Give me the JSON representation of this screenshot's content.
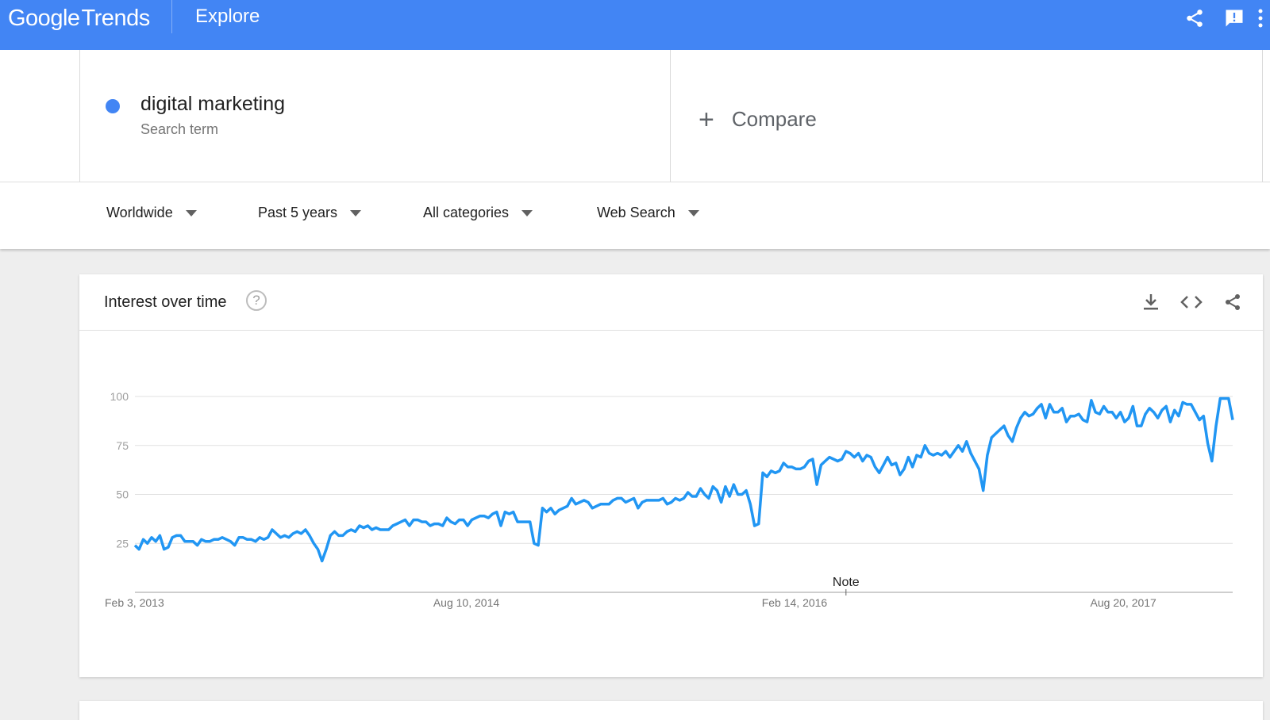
{
  "header": {
    "brand_google": "Google",
    "brand_trends": "Trends",
    "section": "Explore",
    "icons": [
      "share-icon",
      "feedback-icon",
      "more-vert-icon"
    ],
    "color": "#4285f4"
  },
  "term": {
    "name": "digital marketing",
    "sublabel": "Search term",
    "color": "#4285f4"
  },
  "compare": {
    "plus": "+",
    "label": "Compare"
  },
  "filters": [
    {
      "label": "Worldwide"
    },
    {
      "label": "Past 5 years"
    },
    {
      "label": "All categories"
    },
    {
      "label": "Web Search"
    }
  ],
  "card": {
    "title": "Interest over time",
    "help": "?",
    "icons": [
      "download-icon",
      "embed-code-icon",
      "share-icon"
    ]
  },
  "note_label": "Note",
  "chart_data": {
    "type": "line",
    "title": "Interest over time",
    "xlabel": "",
    "ylabel": "",
    "ylim": [
      0,
      100
    ],
    "yticks": [
      25,
      50,
      75,
      100
    ],
    "grid": true,
    "legend": "none",
    "xticks": [
      {
        "label": "Feb 3, 2013",
        "week": 0
      },
      {
        "label": "Aug 10, 2014",
        "week": 79
      },
      {
        "label": "Feb 14, 2016",
        "week": 158
      },
      {
        "label": "Aug 20, 2017",
        "week": 237
      }
    ],
    "series": [
      {
        "color": "#2196f3",
        "values": [
          24,
          22,
          27,
          25,
          28,
          26,
          29,
          22,
          23,
          28,
          29,
          29,
          26,
          26,
          26,
          24,
          27,
          26,
          26,
          27,
          27,
          28,
          27,
          26,
          24,
          28,
          28,
          27,
          27,
          26,
          28,
          27,
          28,
          32,
          30,
          28,
          29,
          28,
          30,
          31,
          30,
          32,
          29,
          25,
          22,
          16,
          22,
          29,
          31,
          29,
          29,
          31,
          32,
          31,
          34,
          33,
          34,
          32,
          33,
          32,
          32,
          32,
          34,
          35,
          36,
          37,
          34,
          37,
          37,
          36,
          36,
          34,
          35,
          35,
          34,
          38,
          36,
          35,
          37,
          37,
          34,
          37,
          38,
          39,
          39,
          38,
          40,
          41,
          34,
          41,
          40,
          41,
          36,
          36,
          36,
          36,
          25,
          24,
          43,
          41,
          43,
          40,
          42,
          43,
          44,
          48,
          45,
          46,
          47,
          46,
          43,
          44,
          45,
          45,
          45,
          47,
          48,
          48,
          46,
          47,
          48,
          43,
          46,
          47,
          47,
          47,
          47,
          48,
          45,
          46,
          48,
          47,
          48,
          51,
          49,
          49,
          53,
          50,
          48,
          54,
          52,
          46,
          54,
          49,
          55,
          50,
          50,
          52,
          45,
          34,
          35,
          61,
          59,
          62,
          61,
          62,
          66,
          64,
          64,
          63,
          63,
          64,
          67,
          68,
          55,
          65,
          67,
          69,
          68,
          67,
          68,
          72,
          71,
          69,
          71,
          67,
          70,
          69,
          64,
          61,
          65,
          69,
          65,
          66,
          60,
          63,
          69,
          64,
          70,
          69,
          75,
          71,
          70,
          71,
          70,
          72,
          69,
          72,
          75,
          72,
          77,
          71,
          67,
          63,
          52,
          70,
          79,
          81,
          83,
          85,
          80,
          77,
          84,
          89,
          92,
          90,
          91,
          94,
          96,
          89,
          96,
          92,
          92,
          94,
          87,
          90,
          90,
          91,
          88,
          87,
          98,
          92,
          91,
          95,
          92,
          92,
          89,
          92,
          87,
          89,
          95,
          85,
          85,
          91,
          94,
          92,
          89,
          93,
          95,
          87,
          93,
          90,
          97,
          96,
          96,
          92,
          88,
          90,
          76,
          67,
          85,
          99,
          99,
          99,
          88
        ]
      }
    ]
  }
}
